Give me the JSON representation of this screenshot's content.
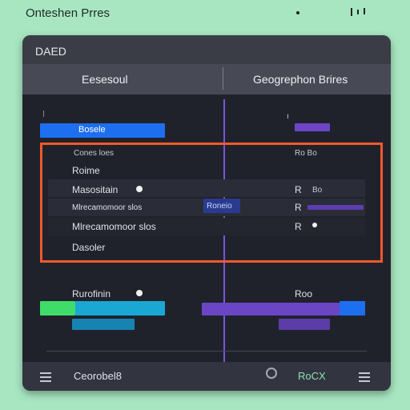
{
  "page": {
    "title": "Onteshen Prres"
  },
  "panel": {
    "label": "DAED",
    "columns": [
      "Eesesoul",
      "Geogrephon Brires"
    ]
  },
  "left_items": {
    "active_label": "Bosele",
    "subhead": "Cones loes",
    "item1": "Roime",
    "item2": "Masositain",
    "item3": "Mlrecamomoor slos",
    "item4": "Dasoler",
    "lower_item": "Rurofinin",
    "middle_tag": "Roneio"
  },
  "right_items": {
    "subhead": "Ro Bo",
    "row1": "R",
    "row1_suffix": "Bo",
    "row2": "R",
    "row3": "R",
    "lower_item": "Roo"
  },
  "footer": {
    "left_label": "Ceorobel8",
    "right_label": "RoCX"
  },
  "colors": {
    "accent_blue": "#1e6ff0",
    "accent_purple": "#7b55d8",
    "selection_orange": "#ef5a2c",
    "green": "#3fdc6a",
    "cyan": "#1aa7d4"
  }
}
